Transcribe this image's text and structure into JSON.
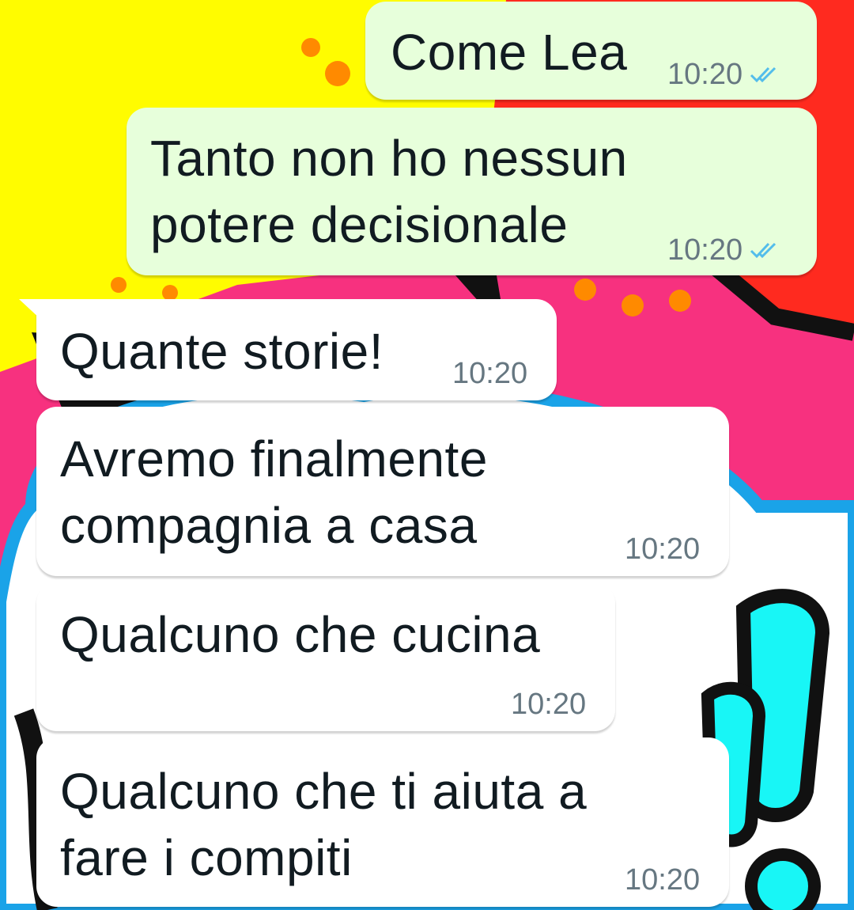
{
  "messages": [
    {
      "direction": "out",
      "lines": [
        "Come Lea"
      ],
      "time": "10:20",
      "status": "read-double-check-icon"
    },
    {
      "direction": "out",
      "lines": [
        "Tanto non ho nessun",
        "potere decisionale"
      ],
      "time": "10:20",
      "status": "read-double-check-icon"
    },
    {
      "direction": "in",
      "lines": [
        "Quante storie!"
      ],
      "time": "10:20"
    },
    {
      "direction": "in",
      "lines": [
        "Avremo finalmente",
        "compagnia a casa"
      ],
      "time": "10:20"
    },
    {
      "direction": "in",
      "lines": [
        "Qualcuno che cucina"
      ],
      "time": "10:20"
    },
    {
      "direction": "in",
      "lines": [
        "Qualcuno che ti aiuta a",
        "fare i compiti"
      ],
      "time": "10:20"
    }
  ],
  "colors": {
    "outgoing_bubble": "#e7ffdb",
    "incoming_bubble": "#ffffff",
    "text": "#111b21",
    "time": "#667781",
    "read_check": "#53bdeb"
  }
}
